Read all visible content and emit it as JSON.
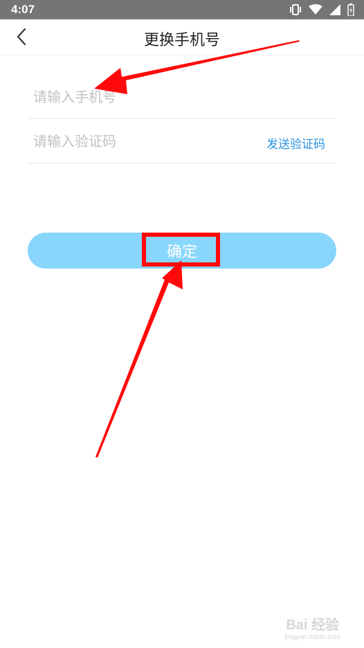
{
  "status_bar": {
    "time": "4:07",
    "icons": [
      "vibrate-icon",
      "wifi-icon",
      "signal-icon",
      "battery-icon"
    ]
  },
  "header": {
    "title": "更换手机号",
    "back_icon": "chevron-left-icon"
  },
  "form": {
    "phone_placeholder": "请输入手机号",
    "code_placeholder": "请输入验证码",
    "send_code_label": "发送验证码"
  },
  "confirm_label": "确定",
  "watermark": {
    "brand": "Bai 经验",
    "url": "jingyan.baidu.com"
  },
  "colors": {
    "status_bar": "#757575",
    "accent_blue": "#2a93e0",
    "button_bg": "#88d6fb",
    "annotation_red": "#ff0a0a"
  }
}
